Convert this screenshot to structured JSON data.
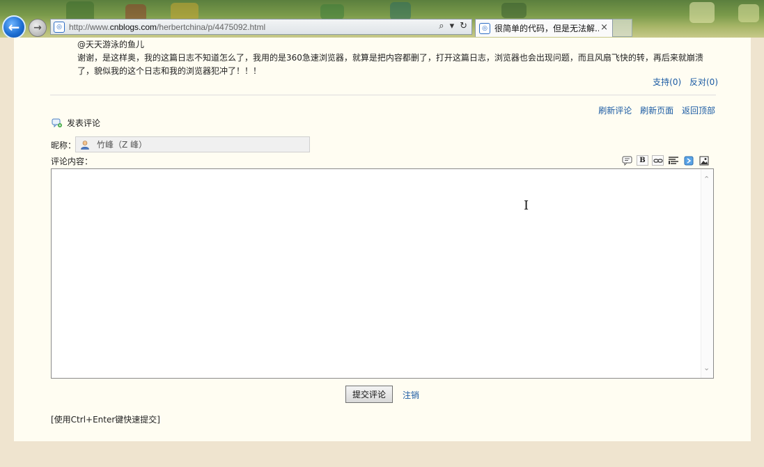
{
  "browser": {
    "url_prefix": "http://www.",
    "url_domain": "cnblogs.com",
    "url_path": "/herbertchina/p/4475092.html",
    "tab_title": "很简单的代码，但是无法解...",
    "tab_close": "×",
    "back_glyph": "←",
    "forward_glyph": "→",
    "search_glyph": "⌕",
    "dropdown_glyph": "▾",
    "refresh_glyph": "↻"
  },
  "comment": {
    "author": "@天天游泳的鱼儿",
    "text": "谢谢，是这样奥，我的这篇日志不知道怎么了，我用的是360急速浏览器，就算是把内容都删了，打开这篇日志，浏览器也会出现问题，而且风扇飞快的转，再后来就崩溃了，貌似我的这个日志和我的浏览器犯冲了！！！",
    "support": "支持(0)",
    "oppose": "反对(0)"
  },
  "links": {
    "refresh_comments": "刷新评论",
    "refresh_page": "刷新页面",
    "back_to_top": "返回顶部"
  },
  "form": {
    "title": "发表评论",
    "nick_label": "昵称：",
    "nick_value": "竹峰（Z 峰）",
    "content_label": "评论内容：",
    "toolbar": {
      "bold": "B"
    },
    "textarea_value": "",
    "submit": "提交评论",
    "logout": "注销",
    "hint": "[使用Ctrl+Enter键快速提交]"
  }
}
